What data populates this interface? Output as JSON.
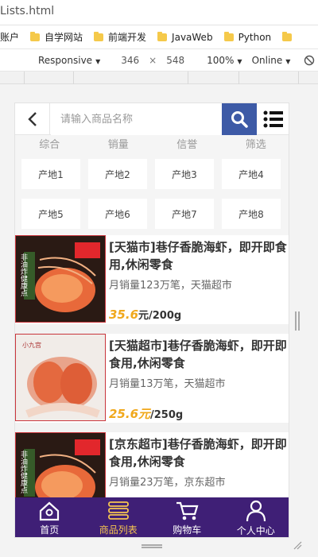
{
  "browser": {
    "tab_title": "Lists.html",
    "bookmarks": [
      "账户",
      "自学网站",
      "前端开发",
      "JavaWeb",
      "Python"
    ],
    "device_mode": "Responsive",
    "width": "346",
    "times": "×",
    "height": "548",
    "zoom": "100%",
    "network": "Online"
  },
  "search": {
    "placeholder": "请输入商品名称",
    "back_icon": "chevron-left-icon",
    "search_icon": "search-icon",
    "menu_icon": "list-icon",
    "accent": "#3d5aa6"
  },
  "sort_tabs": [
    "综合",
    "销量",
    "信誉",
    "筛选"
  ],
  "origins": [
    "产地1",
    "产地2",
    "产地3",
    "产地4",
    "产地5",
    "产地6",
    "产地7",
    "产地8"
  ],
  "products": [
    {
      "title": "[天猫市]巷仔香脆海虾，即开即食用,休闲零食",
      "sales": "月销量123万笔，天猫超市",
      "price": "35.6",
      "unit": "元/200g",
      "image_text": "非油炸健康点"
    },
    {
      "title": "[天猫超市]巷仔香脆海虾，即开即食用,休闲零食",
      "sales": "月销量13万笔，天猫超市",
      "price": "25.6元",
      "unit": "/250g",
      "image_text": "小九宫"
    },
    {
      "title": "[京东超市]巷仔香脆海虾，即开即食用,休闲零食",
      "sales": "月销量23万笔，京东超市",
      "price": "",
      "unit": "",
      "image_text": "非油炸健康点"
    }
  ],
  "nav": {
    "items": [
      {
        "label": "首页",
        "icon": "home-icon"
      },
      {
        "label": "商品列表",
        "icon": "list-icon"
      },
      {
        "label": "购物车",
        "icon": "cart-icon"
      },
      {
        "label": "个人中心",
        "icon": "user-icon"
      }
    ],
    "active_index": 1,
    "background": "#3f1f76",
    "active_color": "#f5c451"
  },
  "price_color": "#f0a81c"
}
